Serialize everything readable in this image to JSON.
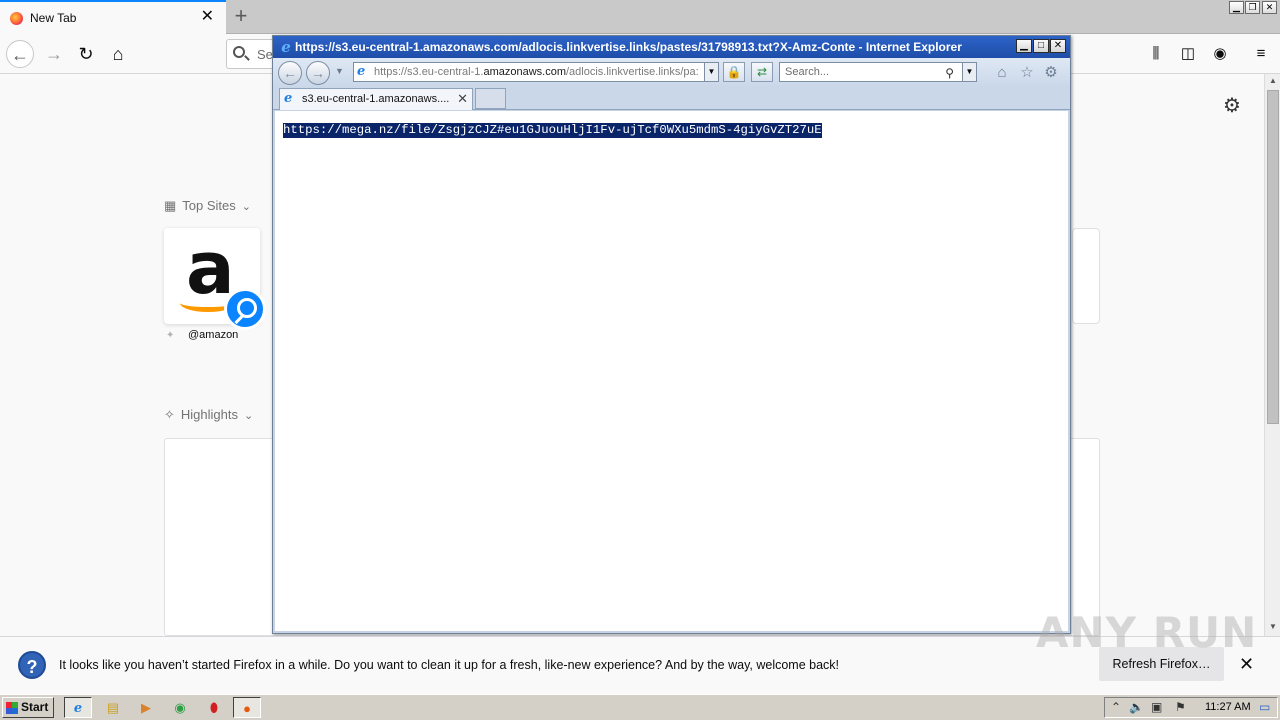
{
  "firefox": {
    "tab_title": "New Tab",
    "search_placeholder": "Se",
    "top_sites_title": "Top Sites",
    "top_site_label": "@amazon",
    "top_site_logo": "a",
    "highlights_title": "Highlights"
  },
  "ie": {
    "title": "https://s3.eu-central-1.amazonaws.com/adlocis.linkvertise.links/pastes/31798913.txt?X-Amz-Conte - Internet Explorer",
    "address_url_prefix": "https://s3.eu-central-1.",
    "address_url_domain": "amazonaws.com",
    "address_url_rest": "/adlocis.linkvertise.links/pa:",
    "search_placeholder": "Search...",
    "tab_title": "s3.eu-central-1.amazonaws....",
    "page_text": "https://mega.nz/file/ZsgjzCJZ#eu1GJuouHljI1Fv-ujTcf0WXu5mdmS-4giyGvZT27uE"
  },
  "notification": {
    "message": "It looks like you haven’t started Firefox in a while. Do you want to clean it up for a fresh, like-new experience? And by the way, welcome back!",
    "refresh_button": "Refresh Firefox…"
  },
  "watermark": "ANY RUN",
  "taskbar": {
    "start_label": "Start",
    "clock": "11:27 AM"
  },
  "icons": {
    "firefox_tab": "firefox-icon",
    "ie_logo": "internet-explorer-icon",
    "help": "question-icon"
  },
  "colors": {
    "ie_selection": "#0a246a",
    "firefox_accent": "#0a84ff",
    "ie_titlebar": "#2d62c7"
  }
}
